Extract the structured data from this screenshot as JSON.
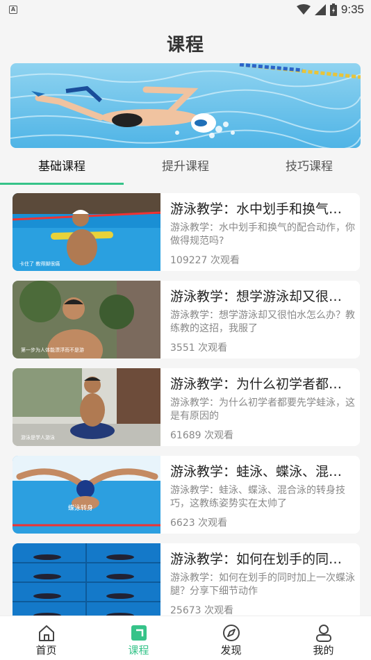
{
  "status_bar": {
    "time": "9:35",
    "app_icon_letter": "A"
  },
  "header": {
    "title": "课程"
  },
  "tabs": [
    {
      "label": "基础课程",
      "active": true
    },
    {
      "label": "提升课程",
      "active": false
    },
    {
      "label": "技巧课程",
      "active": false
    }
  ],
  "courses": [
    {
      "title": "游泳教学：水中划手和换气的配合动作，你做得规范吗?",
      "desc": "游泳教学：水中划手和换气的配合动作，你做得规范吗?",
      "views": "109227 次观看",
      "thumb_caption": "卡住了 教得脚很痛"
    },
    {
      "title": "游泳教学：想学游泳却又很怕水怎么办?",
      "desc": "游泳教学：想学游泳却又很怕水怎么办？教练教的这招，我服了",
      "views": "3551 次观看",
      "thumb_caption": "第一步为人体能漂浮而不是游"
    },
    {
      "title": "游泳教学：为什么初学者都要先学蛙泳",
      "desc": "游泳教学：为什么初学者都要先学蛙泳，这是有原因的",
      "views": "61689 次观看",
      "thumb_caption": "游泳是学人游泳"
    },
    {
      "title": "游泳教学：蛙泳、蝶泳、混合泳的转身技巧",
      "desc": "游泳教学：蛙泳、蝶泳、混合泳的转身技巧，这教练姿势实在太帅了",
      "views": "6623 次观看",
      "thumb_caption": "蝶泳转身"
    },
    {
      "title": "游泳教学：如何在划手的同时加上一次蝶泳腿",
      "desc": "游泳教学：如何在划手的同时加上一次蝶泳腿？分享下细节动作",
      "views": "25673 次观看",
      "thumb_caption": ""
    }
  ],
  "bottom_nav": [
    {
      "label": "首页",
      "icon": "home-icon",
      "active": false
    },
    {
      "label": "课程",
      "icon": "course-icon",
      "active": true
    },
    {
      "label": "发现",
      "icon": "discover-icon",
      "active": false
    },
    {
      "label": "我的",
      "icon": "profile-icon",
      "active": false
    }
  ],
  "colors": {
    "accent": "#36c389",
    "background": "#f5f5f5"
  }
}
